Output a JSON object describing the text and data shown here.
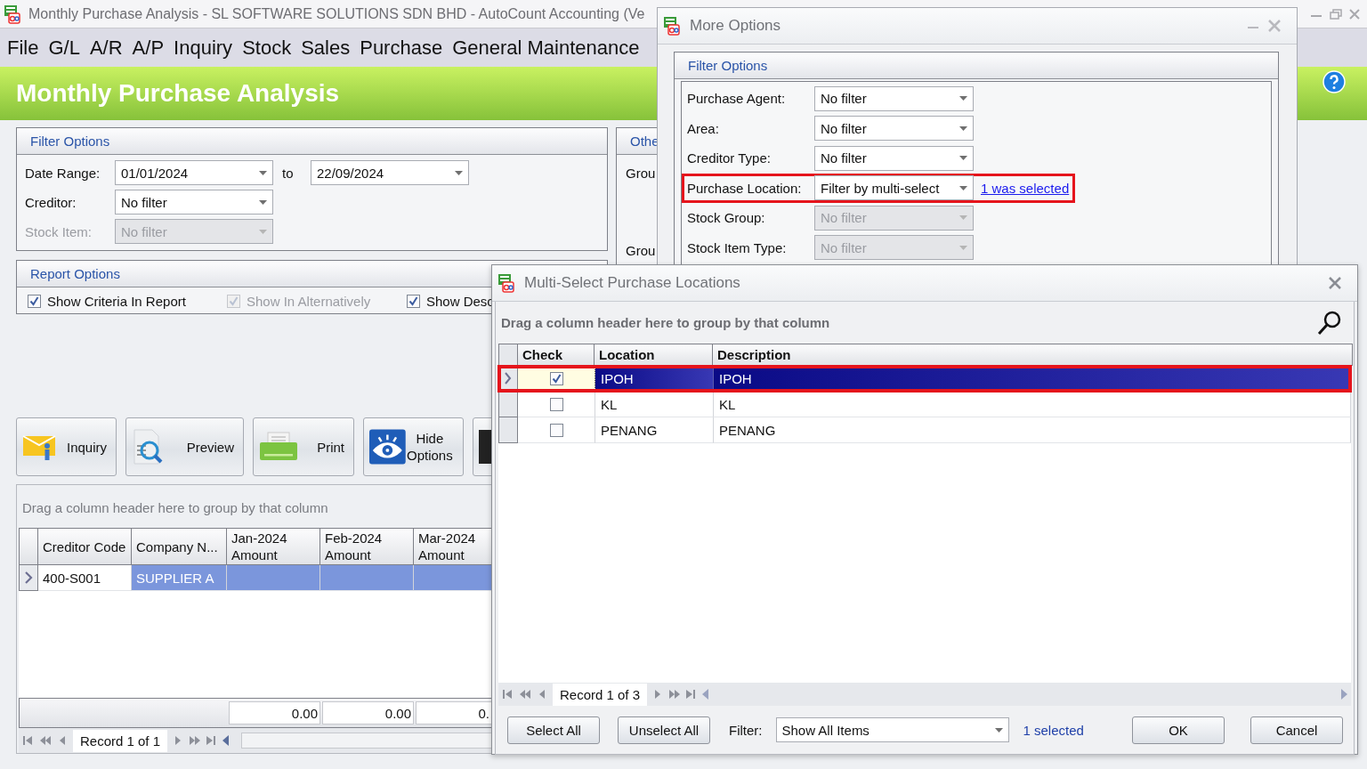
{
  "main_window": {
    "title": "Monthly Purchase Analysis - SL SOFTWARE SOLUTIONS SDN BHD - AutoCount Accounting (Ve",
    "menu": [
      "File",
      "G/L",
      "A/R",
      "A/P",
      "Inquiry",
      "Stock",
      "Sales",
      "Purchase",
      "General Maintenance"
    ],
    "banner_title": "Monthly Purchase Analysis",
    "filter_options": {
      "title": "Filter Options",
      "date_range": {
        "label": "Date Range:",
        "from": "01/01/2024",
        "separator": "to",
        "to": "22/09/2024"
      },
      "fields": [
        {
          "label": "Creditor:",
          "value": "No filter",
          "disabled": false
        },
        {
          "label": "Stock Item:",
          "value": "No filter",
          "disabled": true
        }
      ]
    },
    "other_options": {
      "title": "Othe",
      "labels": [
        "Grou",
        "Grou"
      ]
    },
    "report_options": {
      "title": "Report Options",
      "checkboxes": [
        {
          "label": "Show Criteria In Report",
          "checked": true,
          "disabled": false
        },
        {
          "label": "Show In Alternatively",
          "checked": true,
          "disabled": true
        },
        {
          "label": "Show Desc",
          "checked": true,
          "disabled": false
        }
      ]
    },
    "toolbar": [
      {
        "kind": "inquiry",
        "label": "Inquiry"
      },
      {
        "kind": "preview",
        "label": "Preview"
      },
      {
        "kind": "print",
        "label": "Print"
      },
      {
        "kind": "hide_options",
        "label": "Hide Options"
      }
    ],
    "grid": {
      "group_hint": "Drag a column header here to group by that column",
      "columns": [
        {
          "lines": [
            "Creditor Code"
          ]
        },
        {
          "lines": [
            "Company N..."
          ]
        },
        {
          "lines": [
            "Jan-2024",
            "Amount"
          ]
        },
        {
          "lines": [
            "Feb-2024",
            "Amount"
          ]
        },
        {
          "lines": [
            "Mar-2024",
            "Amount"
          ]
        }
      ],
      "rows": [
        {
          "cells": [
            "400-S001",
            "SUPPLIER A"
          ],
          "selected": true
        }
      ],
      "totals": [
        "0.00",
        "0.00",
        "0."
      ],
      "navigator": "Record 1 of 1"
    }
  },
  "more_options": {
    "title": "More Options",
    "group_title": "Filter Options",
    "fields": [
      {
        "label": "Purchase Agent:",
        "value": "No filter",
        "disabled": false,
        "highlighted": false
      },
      {
        "label": "Area:",
        "value": "No filter",
        "disabled": false,
        "highlighted": false
      },
      {
        "label": "Creditor Type:",
        "value": "No filter",
        "disabled": false,
        "highlighted": false
      },
      {
        "label": "Purchase Location:",
        "value": "Filter by multi-select",
        "disabled": false,
        "highlighted": true,
        "link": "1 was selected"
      },
      {
        "label": "Stock Group:",
        "value": "No filter",
        "disabled": true,
        "highlighted": false
      },
      {
        "label": "Stock Item Type:",
        "value": "No filter",
        "disabled": true,
        "highlighted": false
      }
    ]
  },
  "multi_select": {
    "title": "Multi-Select Purchase Locations",
    "group_hint": "Drag a column header here to group by that column",
    "columns": [
      "Check",
      "Location",
      "Description"
    ],
    "rows": [
      {
        "checked": true,
        "location": "IPOH",
        "description": "IPOH",
        "selected": true,
        "highlighted": true
      },
      {
        "checked": false,
        "location": "KL",
        "description": "KL",
        "selected": false,
        "highlighted": false
      },
      {
        "checked": false,
        "location": "PENANG",
        "description": "PENANG",
        "selected": false,
        "highlighted": false
      }
    ],
    "navigator": "Record 1 of 3",
    "buttons": [
      "Select All",
      "Unselect All"
    ],
    "filter": {
      "label": "Filter:",
      "value": "Show All Items"
    },
    "selected_count": "1 selected",
    "actions": [
      "OK",
      "Cancel"
    ]
  }
}
